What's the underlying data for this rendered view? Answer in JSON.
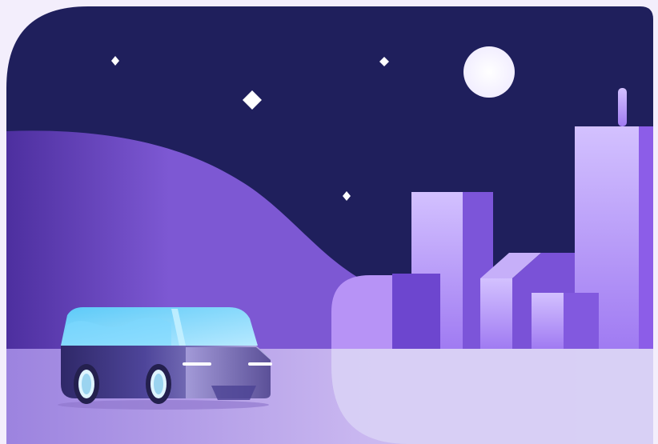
{
  "scene": {
    "subject": "night-city-car-illustration",
    "colors": {
      "page_bg": "#f3eefc",
      "sky": "#1f1f5c",
      "hill_dark": "#5435a6",
      "hill_light": "#8a63d8",
      "ground_left": "#a58be0",
      "ground_right": "#d8d0f4",
      "building_light": "#c7b0ff",
      "building_mid": "#9b73f0",
      "building_dark": "#6f47cf",
      "moon": "#f4f1ff",
      "star": "#ffffff",
      "car_glass": "#5fc8f6",
      "car_body": "#3c347a",
      "car_body_light": "#9d95d8",
      "headlight": "#ffffff"
    },
    "elements": [
      "moon",
      "stars",
      "hill",
      "city-buildings",
      "car"
    ]
  }
}
